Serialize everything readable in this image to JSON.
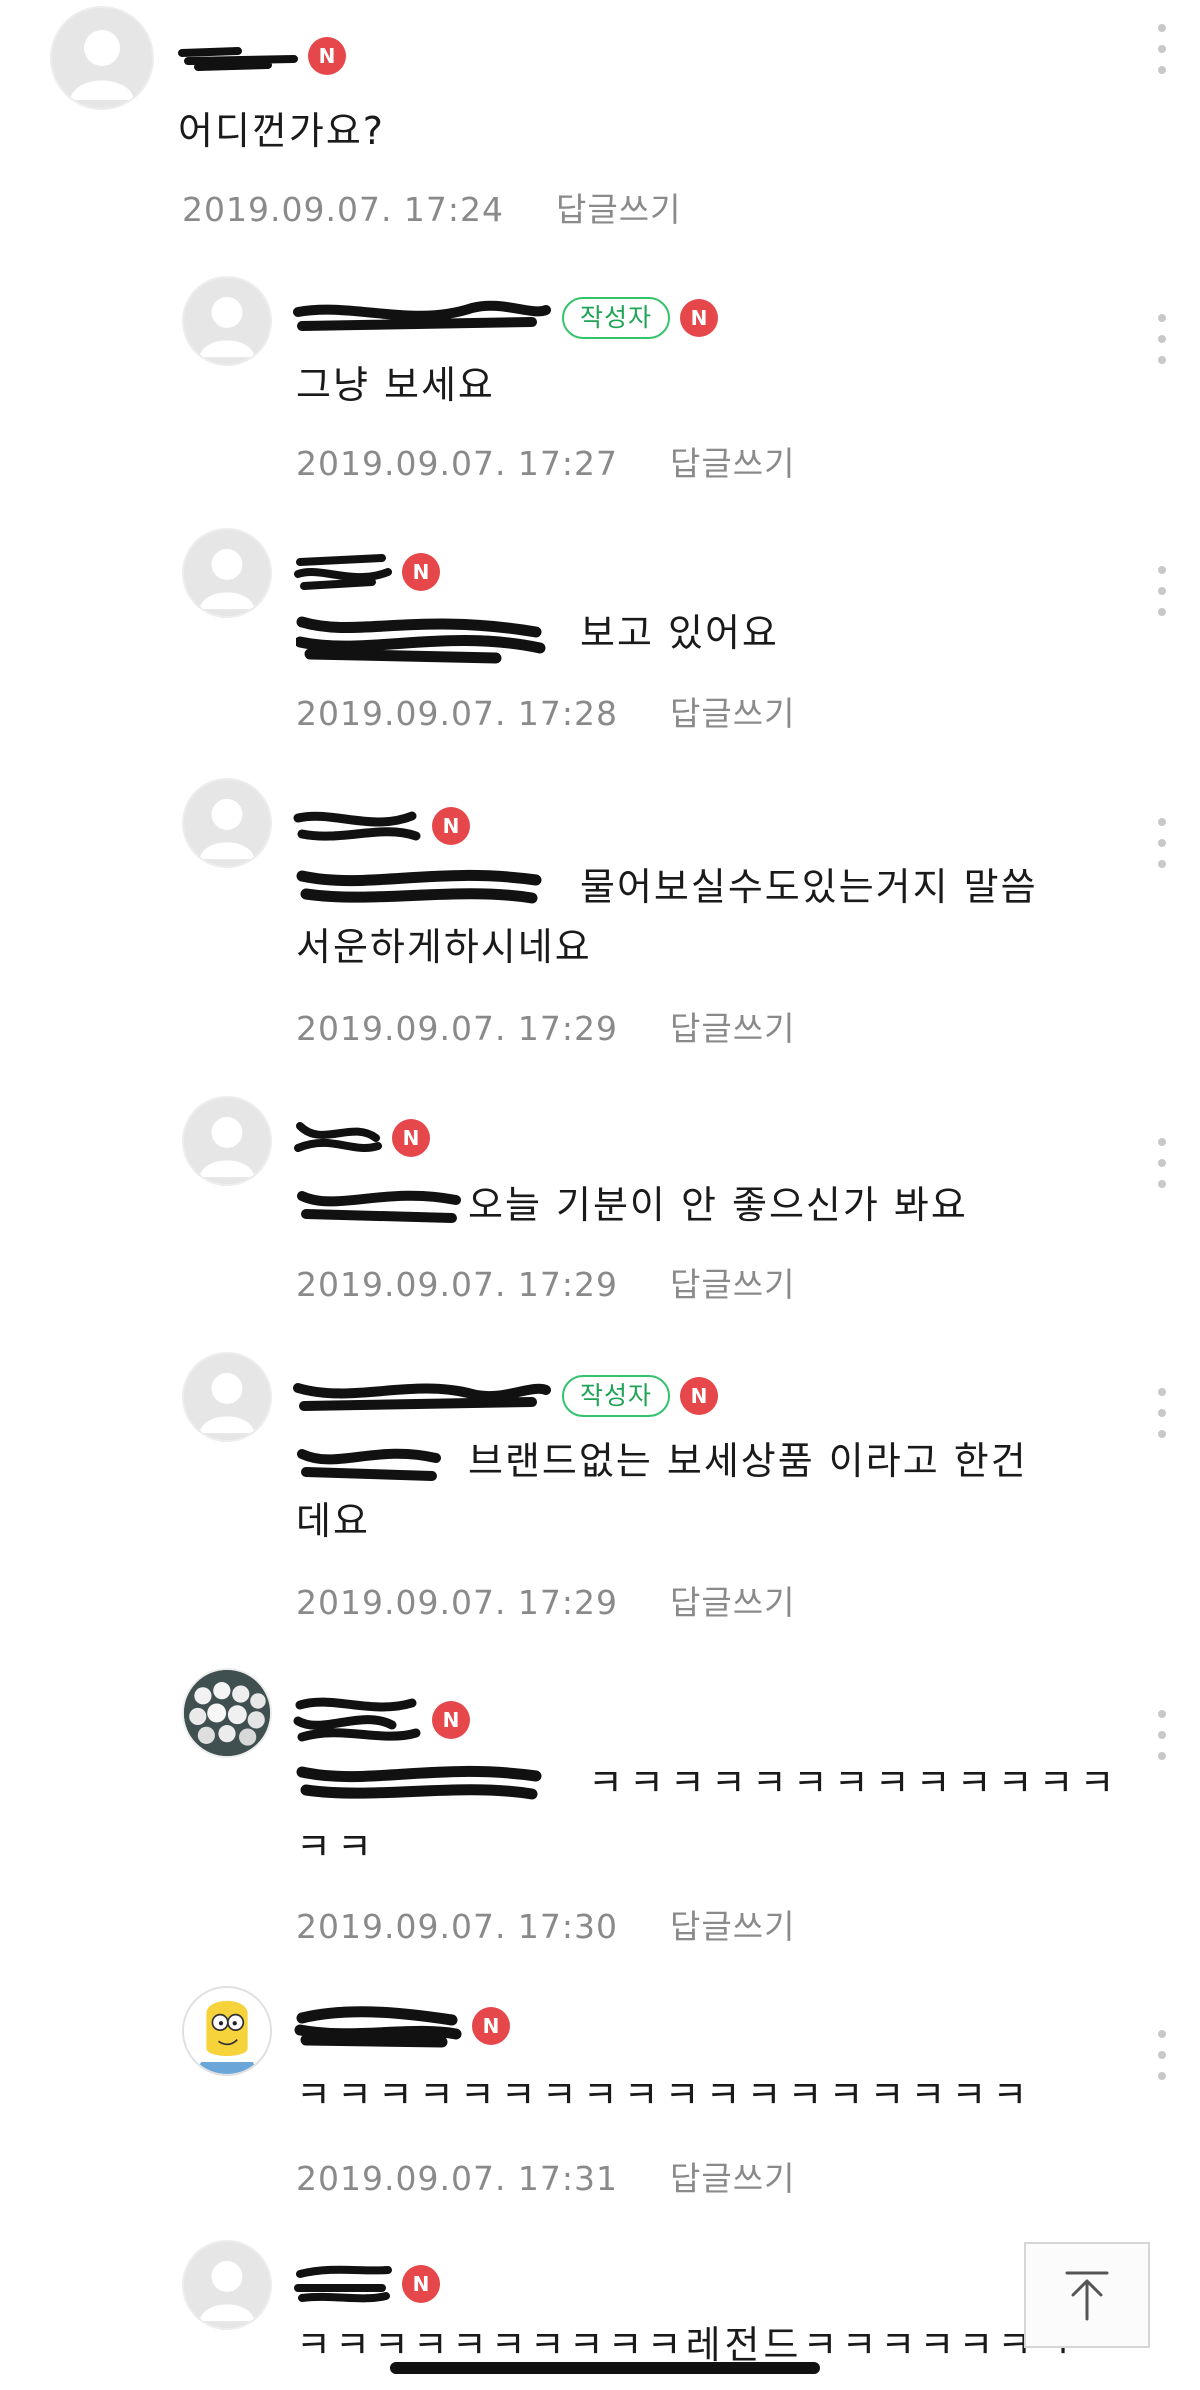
{
  "comments": [
    {
      "text": "어디껀가요?",
      "timestamp": "2019.09.07. 17:24",
      "reply": "답글쓰기",
      "badge": "N"
    },
    {
      "text": "그냥 보세요",
      "timestamp": "2019.09.07. 17:27",
      "reply": "답글쓰기",
      "badge": "N",
      "author_badge": "작성자"
    },
    {
      "text": "보고 있어요",
      "timestamp": "2019.09.07. 17:28",
      "reply": "답글쓰기",
      "badge": "N"
    },
    {
      "text": "물어보실수도있는거지 말씀",
      "text2": "서운하게하시네요",
      "timestamp": "2019.09.07. 17:29",
      "reply": "답글쓰기",
      "badge": "N"
    },
    {
      "text": "오늘 기분이 안 좋으신가 봐요",
      "timestamp": "2019.09.07. 17:29",
      "reply": "답글쓰기",
      "badge": "N"
    },
    {
      "text": "브랜드없는 보세상품 이라고 한건",
      "text2": "데요",
      "timestamp": "2019.09.07. 17:29",
      "reply": "답글쓰기",
      "badge": "N",
      "author_badge": "작성자"
    },
    {
      "text": "ㅋㅋㅋㅋㅋㅋㅋㅋㅋㅋㅋㅋㅋ",
      "text2": "ㅋㅋ",
      "timestamp": "2019.09.07. 17:30",
      "reply": "답글쓰기",
      "badge": "N"
    },
    {
      "text": "ㅋㅋㅋㅋㅋㅋㅋㅋㅋㅋㅋㅋㅋㅋㅋㅋㅋㅋ",
      "timestamp": "2019.09.07. 17:31",
      "reply": "답글쓰기",
      "badge": "N"
    },
    {
      "text": "ㅋㅋㅋㅋㅋㅋㅋㅋㅋㅋ레전드ㅋㅋㅋㅋㅋㅋㅋ",
      "badge": "N"
    }
  ],
  "icons": {
    "avatar": "default-avatar-icon",
    "more": "kebab-menu-icon",
    "scroll_top": "arrow-up-icon"
  },
  "colors": {
    "new_badge": "#e5474b",
    "author_badge": "#33c46b",
    "meta_text": "#8a8a8a"
  }
}
